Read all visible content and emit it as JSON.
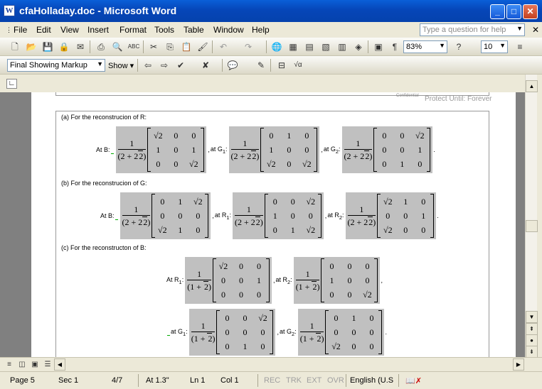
{
  "window": {
    "title": "cfaHolladay.doc - Microsoft Word",
    "app_icon": "W"
  },
  "menu": [
    "File",
    "Edit",
    "View",
    "Insert",
    "Format",
    "Tools",
    "Table",
    "Window",
    "Help"
  ],
  "ask_placeholder": "Type a question for help",
  "toolbar": {
    "zoom": "83%",
    "font_size": "10"
  },
  "review": {
    "markup": "Final Showing Markup",
    "show": "Show"
  },
  "header": {
    "confidential": "Confidential",
    "protect": "Protect Until: Forever"
  },
  "doc": {
    "sec_a": "(a)  For the reconstrucion of R:",
    "sec_b": "(b)  For the reconstrucion of G:",
    "sec_c": "(c)  For the reconstructon of B:",
    "num": "1",
    "den1": "(2 + 2",
    "den2": "(1 + ",
    "sqrt2": "√2",
    "r2": "2",
    "close": ")",
    "comma": ",",
    "period": ".",
    "at": "At ",
    "at_l": "at ",
    "B": "B",
    "G": "G",
    "R": "R",
    "sub1": "1",
    "sub2": "2",
    "zero": "0",
    "one": "1",
    "colon": ":"
  },
  "status": {
    "page": "Page  5",
    "sec": "Sec  1",
    "pages": "4/7",
    "at": "At  1.3\"",
    "ln": "Ln  1",
    "col": "Col  1",
    "rec": "REC",
    "trk": "TRK",
    "ext": "EXT",
    "ovr": "OVR",
    "lang": "English (U.S"
  }
}
